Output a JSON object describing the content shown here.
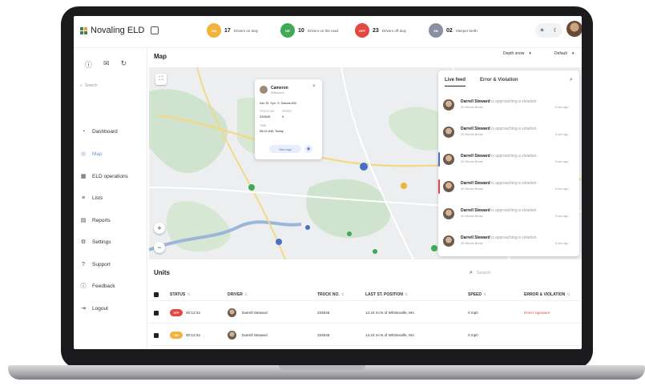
{
  "app": {
    "name": "Novaling ELD"
  },
  "topbar": {
    "stats": [
      {
        "badge": "ON",
        "count": "17",
        "label": "Drivers on duty",
        "color": "#f2b33c"
      },
      {
        "badge": "DR",
        "count": "10",
        "label": "Drivers on the road",
        "color": "#3eaa55"
      },
      {
        "badge": "OFF",
        "count": "23",
        "label": "Drivers off duty",
        "color": "#e2493f"
      },
      {
        "badge": "SB",
        "count": "02",
        "label": "Sleeper berth",
        "color": "#8a8fa3"
      }
    ],
    "theme": {
      "light": "☀",
      "dark": "☾"
    }
  },
  "sidebar": {
    "search_placeholder": "Search",
    "items": [
      {
        "label": "Dashboard",
        "icon": "dashboard-icon",
        "glyph": "◔"
      },
      {
        "label": "Map",
        "icon": "map-icon",
        "glyph": "◎",
        "active": true
      },
      {
        "label": "ELD operations",
        "icon": "eld-icon",
        "glyph": "▦"
      },
      {
        "label": "Lists",
        "icon": "list-icon",
        "glyph": "≡"
      },
      {
        "label": "Reports",
        "icon": "report-icon",
        "glyph": "▤"
      },
      {
        "label": "Settings",
        "icon": "settings-icon",
        "glyph": "⚙"
      },
      {
        "label": "Support",
        "icon": "support-icon",
        "glyph": "?"
      },
      {
        "label": "Feedback",
        "icon": "feedback-icon",
        "glyph": "ⓘ"
      },
      {
        "label": "Logout",
        "icon": "logout-icon",
        "glyph": "⇥"
      }
    ]
  },
  "map": {
    "title": "Map",
    "dropdown1": "Depth snow",
    "dropdown2": "Default",
    "popup": {
      "name": "Cameron",
      "subtitle": "Williamson",
      "address": "Ash St. Syn, S. Dakota 834",
      "truck_label": "TRUCK NO.",
      "truck_value": "334545",
      "speed_label": "SPEED",
      "speed_value": "0",
      "time_label": "TIME",
      "time_value": "08:21 AM, Today",
      "button": "See logs"
    }
  },
  "feed": {
    "tabs": [
      "Live feed",
      "Error & Violation"
    ],
    "items": [
      {
        "name": "Darrell Steward",
        "text": "is approaching a violation",
        "sub": "30 Minute Break",
        "time": "5 sec ago",
        "accent": ""
      },
      {
        "name": "Darrell Steward",
        "text": "is approaching a violation",
        "sub": "30 Minute Break",
        "time": "5 sec ago",
        "accent": ""
      },
      {
        "name": "Darrell Steward",
        "text": "is approaching a violation",
        "sub": "30 Minute Break",
        "time": "5 sec ago",
        "accent": "#4a6fc6"
      },
      {
        "name": "Darrell Steward",
        "text": "is approaching a violation",
        "sub": "30 Minute Break",
        "time": "5 sec ago",
        "accent": "#e2493f"
      },
      {
        "name": "Darrell Steward",
        "text": "is approaching a violation",
        "sub": "30 Minute Break",
        "time": "5 sec ago",
        "accent": ""
      },
      {
        "name": "Darrell Steward",
        "text": "is approaching a violation",
        "sub": "30 Minute Break",
        "time": "5 sec ago",
        "accent": ""
      }
    ]
  },
  "units": {
    "title": "Units",
    "search_placeholder": "Search",
    "columns": [
      "STATUS",
      "DRIVER",
      "TRUCK NO.",
      "LAST ST. POSITION",
      "SPEED",
      "ERROR & VIOLATION"
    ],
    "rows": [
      {
        "status": "OFF",
        "status_color": "#e2493f",
        "time": "00:12:32",
        "driver": "Darrell Steward",
        "truck": "334545",
        "position": "14.24 mi N of Whitinsville, MA",
        "speed": "0 mph",
        "error": "Driver signature"
      },
      {
        "status": "ON",
        "status_color": "#f2b33c",
        "time": "00:12:32",
        "driver": "Darrell Steward",
        "truck": "334545",
        "position": "14.24 mi N of Whitinsville, MA",
        "speed": "0 mph",
        "error": ""
      }
    ]
  }
}
